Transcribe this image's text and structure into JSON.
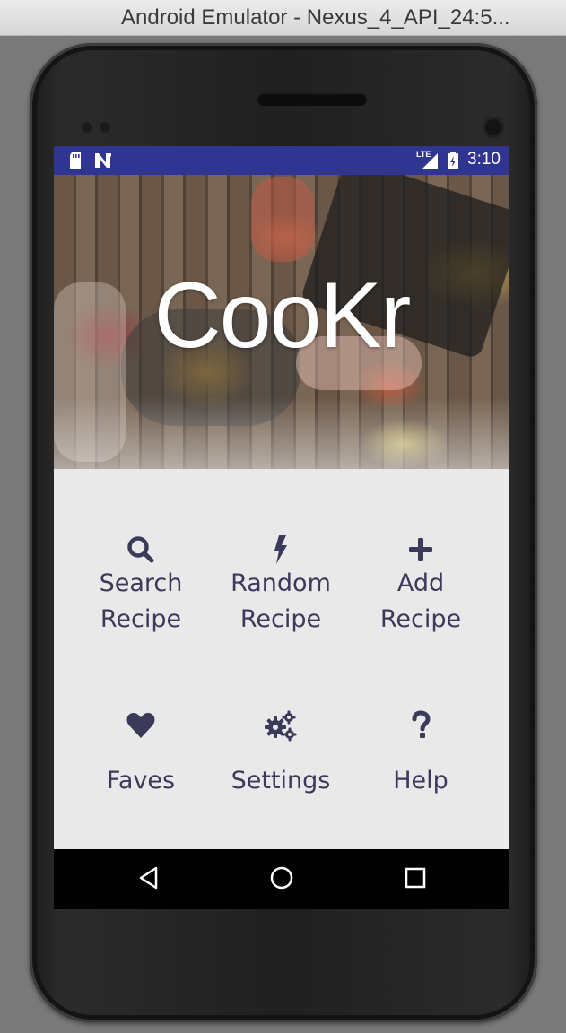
{
  "window": {
    "title": "Android Emulator - Nexus_4_API_24:5..."
  },
  "status_bar": {
    "time": "3:10",
    "network_label": "LTE",
    "icons": [
      "sd-card-icon",
      "n-notification-icon",
      "lte-signal-icon",
      "battery-icon"
    ]
  },
  "hero": {
    "title": "CooKr"
  },
  "menu": {
    "items": [
      {
        "label": "Search\nRecipe",
        "icon": "search-icon"
      },
      {
        "label": "Random\nRecipe",
        "icon": "lightning-icon"
      },
      {
        "label": "Add\nRecipe",
        "icon": "plus-icon"
      },
      {
        "label": "Faves",
        "icon": "heart-icon"
      },
      {
        "label": "Settings",
        "icon": "gears-icon"
      },
      {
        "label": "Help",
        "icon": "question-icon"
      }
    ]
  },
  "nav_bar": {
    "buttons": [
      "back-icon",
      "home-icon",
      "recents-icon"
    ]
  },
  "colors": {
    "status_bar": "#2f3591",
    "menu_text": "#3b3a5a",
    "screen_background": "#e9e9e9",
    "nav_bar": "#000000"
  }
}
